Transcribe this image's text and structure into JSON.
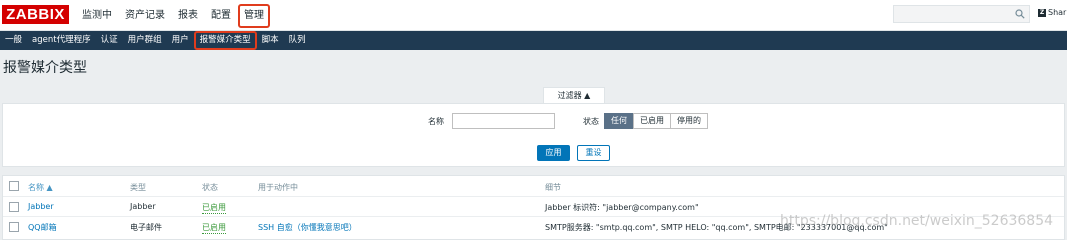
{
  "topbar": {
    "logo": "ZABBIX",
    "menu": [
      "监测中",
      "资产记录",
      "报表",
      "配置",
      "管理"
    ],
    "search_placeholder": "",
    "share_label": "Shar"
  },
  "submenu": [
    "一般",
    "agent代理程序",
    "认证",
    "用户群组",
    "用户",
    "报警媒介类型",
    "脚本",
    "队列"
  ],
  "page_title": "报警媒介类型",
  "filter": {
    "tab_label": "过滤器 ▲",
    "name_label": "名称",
    "name_value": "",
    "status_label": "状态",
    "status_options": [
      "任何",
      "已启用",
      "停用的"
    ],
    "apply_label": "应用",
    "reset_label": "重设"
  },
  "table": {
    "headers": [
      "名称 ▲",
      "类型",
      "状态",
      "用于动作中",
      "细节"
    ],
    "rows": [
      {
        "name": "Jabber",
        "type": "Jabber",
        "status": "已启用",
        "actions": "",
        "details": "Jabber 标识符: \"jabber@company.com\""
      },
      {
        "name": "QQ邮箱",
        "type": "电子邮件",
        "status": "已启用",
        "actions": "SSH 自愈（你懂我意思吧）",
        "details": "SMTP服务器: \"smtp.qq.com\", SMTP HELO: \"qq.com\", SMTP电邮: \"233337001@qq.com\""
      }
    ]
  },
  "watermark": "https://blog.csdn.net/weixin_52636854",
  "colors": {
    "brand": "#d40000",
    "nav": "#1f3a52",
    "link": "#0275b8",
    "highlight": "#e03c1d",
    "enabled": "#3c9a3c"
  }
}
